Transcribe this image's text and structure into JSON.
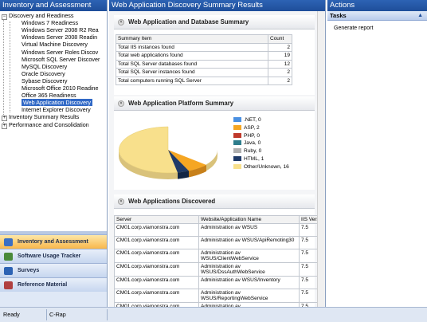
{
  "left_pane": {
    "title": "Inventory and Assessment",
    "tree": [
      {
        "label": "Discovery and Readiness",
        "toggle": "−",
        "depth": 0
      },
      {
        "label": "Windows 7 Readiness",
        "depth": 1
      },
      {
        "label": "Windows Server 2008 R2 Rea",
        "depth": 1
      },
      {
        "label": "Windows Server 2008 Readin",
        "depth": 1
      },
      {
        "label": "Virtual Machine Discovery",
        "depth": 1
      },
      {
        "label": "Windows Server Roles Discov",
        "depth": 1
      },
      {
        "label": "Microsoft SQL Server Discover",
        "depth": 1
      },
      {
        "label": "MySQL Discovery",
        "depth": 1
      },
      {
        "label": "Oracle Discovery",
        "depth": 1
      },
      {
        "label": "Sybase Discovery",
        "depth": 1
      },
      {
        "label": "Microsoft Office 2010 Readine",
        "depth": 1
      },
      {
        "label": "Office 365 Readiness",
        "depth": 1
      },
      {
        "label": "Web Application Discovery",
        "depth": 1,
        "selected": true
      },
      {
        "label": "Internet Explorer Discovery",
        "depth": 1
      },
      {
        "label": "Inventory Summary Results",
        "toggle": "+",
        "depth": 0
      },
      {
        "label": "Performance and Consolidation",
        "toggle": "+",
        "depth": 0
      }
    ]
  },
  "nav": {
    "items": [
      {
        "label": "Inventory and Assessment",
        "active": true,
        "icon": "inventory-icon",
        "color": "#3a6fc4"
      },
      {
        "label": "Software Usage Tracker",
        "icon": "tracker-icon",
        "color": "#4a8a3a"
      },
      {
        "label": "Surveys",
        "icon": "survey-icon",
        "color": "#2d63b4"
      },
      {
        "label": "Reference Material",
        "icon": "book-icon",
        "color": "#b04040"
      }
    ]
  },
  "center": {
    "title": "Web Application Discovery Summary Results",
    "summary": {
      "heading": "Web Application and Database Summary",
      "columns": [
        "Summary Item",
        "Count"
      ],
      "rows": [
        {
          "item": "Total IIS instances found",
          "count": "2"
        },
        {
          "item": "Total web applications found",
          "count": "19"
        },
        {
          "item": "Total SQL Server databases found",
          "count": "12"
        },
        {
          "item": "Total SQL Server instances found",
          "count": "2"
        },
        {
          "item": "Total computers running SQL Server",
          "count": "2"
        }
      ]
    },
    "platform": {
      "heading": "Web Application Platform Summary",
      "legend": [
        {
          "label": ".NET, 0",
          "color": "#4a90e2"
        },
        {
          "label": "ASP, 2",
          "color": "#f5a623"
        },
        {
          "label": "PHP, 0",
          "color": "#c0392b"
        },
        {
          "label": "Java, 0",
          "color": "#2e7d8c"
        },
        {
          "label": "Ruby, 0",
          "color": "#b0b0b0"
        },
        {
          "label": "HTML, 1",
          "color": "#1f3a68"
        },
        {
          "label": "Other/Unknown, 16",
          "color": "#f8e08c"
        }
      ]
    },
    "apps": {
      "heading": "Web Applications Discovered",
      "columns": [
        "Server",
        "Website/Application Name",
        "IIS Versi"
      ],
      "rows": [
        {
          "server": "CM01.corp.viamonstra.com",
          "name": "Administration av WSUS",
          "iis": "7.5"
        },
        {
          "server": "CM01.corp.viamonstra.com",
          "name": "Administration av WSUS/ApiRemoting30",
          "iis": "7.5"
        },
        {
          "server": "CM01.corp.viamonstra.com",
          "name": "Administration av WSUS/ClientWebService",
          "iis": "7.5"
        },
        {
          "server": "CM01.corp.viamonstra.com",
          "name": "Administration av WSUS/DssAuthWebService",
          "iis": "7.5"
        },
        {
          "server": "CM01.corp.viamonstra.com",
          "name": "Administration av WSUS/Inventory",
          "iis": "7.5"
        },
        {
          "server": "CM01.corp.viamonstra.com",
          "name": "Administration av WSUS/ReportingWebService",
          "iis": "7.5"
        },
        {
          "server": "CM01.corp.viamonstra.com",
          "name": "Administration av WSUS/ServerSyncWebService",
          "iis": "7.5"
        }
      ]
    }
  },
  "actions": {
    "title": "Actions",
    "tasks_heading": "Tasks",
    "tasks": [
      {
        "label": "Generate report"
      }
    ]
  },
  "status": {
    "left": "Ready",
    "right": "C-Rap"
  }
}
